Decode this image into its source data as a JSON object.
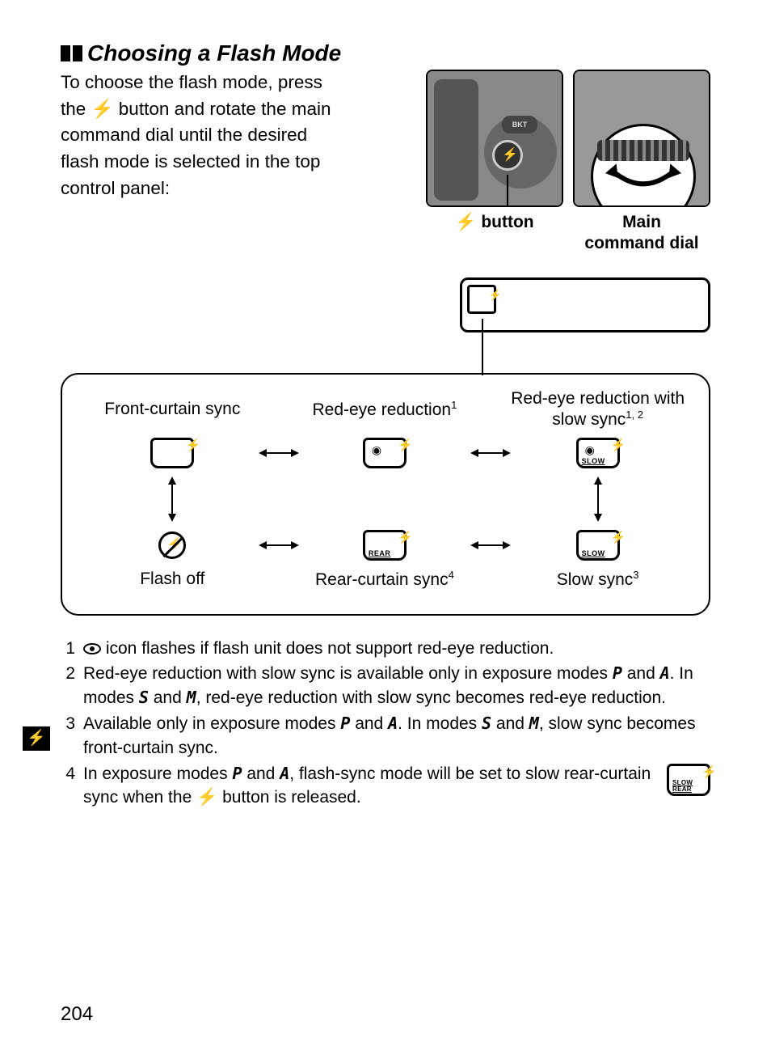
{
  "heading": "Choosing a Flash Mode",
  "intro": {
    "l1": "To choose the flash mode, press",
    "l2a": "the ",
    "l2b": " button and rotate the main",
    "l3": "command dial until the desired",
    "l4": "flash mode is selected in the top",
    "l5": "control panel:"
  },
  "fig1_caption_a": " button",
  "fig2_caption_a": "Main",
  "fig2_caption_b": "command dial",
  "modes": {
    "front": "Front-curtain sync",
    "redeye": "Red-eye reduction",
    "redeye_sup": "1",
    "redeye_slow_a": "Red-eye reduction with",
    "redeye_slow_b": "slow sync",
    "redeye_slow_sup": "1, 2",
    "flashoff": "Flash off",
    "rear": "Rear-curtain sync",
    "rear_sup": "4",
    "slow": "Slow sync",
    "slow_sup": "3",
    "icon_slow_text": "SLOW",
    "icon_rear_text": "REAR"
  },
  "footnotes": {
    "n1": "1",
    "f1_a": " icon flashes if flash unit does not support red-eye reduction.",
    "n2": "2",
    "f2_a": "Red-eye reduction with slow sync is available only in exposure modes ",
    "f2_b": " and ",
    "f2_c": ".  In modes ",
    "f2_d": " and ",
    "f2_e": ", red-eye reduction with slow sync becomes red-eye reduction.",
    "n3": "3",
    "f3_a": "Available only in exposure modes ",
    "f3_b": " and ",
    "f3_c": ".  In modes ",
    "f3_d": " and ",
    "f3_e": ", slow sync becomes front-curtain sync.",
    "n4": "4",
    "f4_a": "In exposure modes ",
    "f4_b": " and ",
    "f4_c": ", flash-sync mode will be set to slow rear-curtain sync when the ",
    "f4_d": " button is released.",
    "inline_icon_text": "SLOW\nREAR",
    "modeP": "P",
    "modeA": "A",
    "modeS": "S",
    "modeM": "M"
  },
  "page_number": "204",
  "flash_glyph": "⚡",
  "bkt_label": "BKT"
}
